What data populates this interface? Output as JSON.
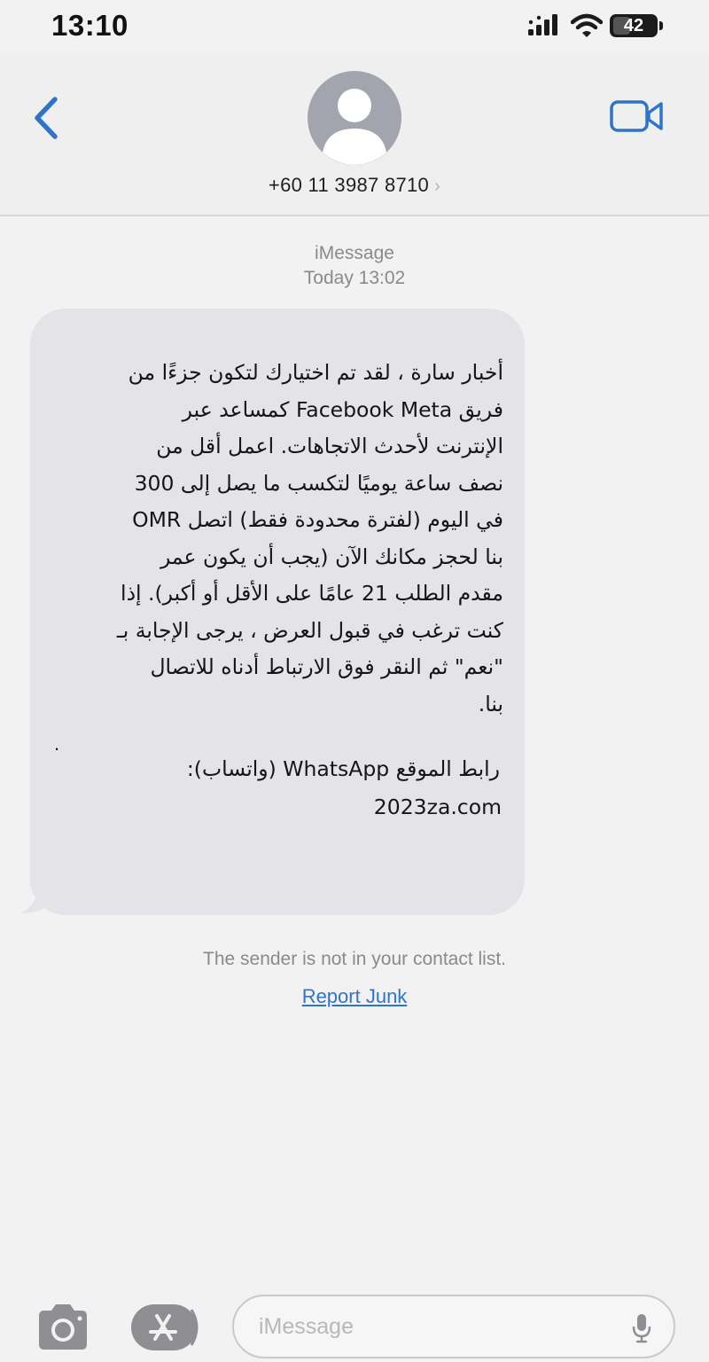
{
  "status_bar": {
    "time": "13:10",
    "battery_percent": 42,
    "battery_label": "42",
    "icons": [
      "signal-icon",
      "wifi-icon",
      "battery-icon"
    ]
  },
  "header": {
    "contact_number": "+60 11 3987 8710",
    "chevron": "›",
    "icons": [
      "back-chevron-icon",
      "avatar-person-icon",
      "video-camera-icon"
    ],
    "accent_color": "#2f74c9"
  },
  "thread": {
    "service_label": "iMessage",
    "timestamp": "Today 13:02"
  },
  "message": {
    "body": "أخبار سارة ، لقد تم اختيارك لتكون جزءًا من\nفريق Facebook Meta كمساعد عبر\nالإنترنت لأحدث الاتجاهات. اعمل أقل من\nنصف ساعة يوميًا لتكسب ما يصل إلى 300\nOMR في اليوم (لفترة محدودة فقط) اتصل\nبنا لحجز مكانك الآن (يجب أن يكون عمر\nمقدم الطلب 21 عامًا على الأقل أو أكبر). إذا\nكنت ترغب في قبول العرض ، يرجى الإجابة بـ\n\"نعم\" ثم النقر فوق الارتباط أدناه للاتصال\nبنا.",
    "dot": ".",
    "link_label": "رابط الموقع WhatsApp (واتساب):",
    "link_url": "2023za.com",
    "bubble_color": "#e4e4e8"
  },
  "notice": {
    "text": "The sender is not in your contact list.",
    "report_label": "Report Junk"
  },
  "input_bar": {
    "placeholder": "iMessage",
    "icons": [
      "camera-icon",
      "app-store-icon",
      "microphone-icon"
    ]
  }
}
